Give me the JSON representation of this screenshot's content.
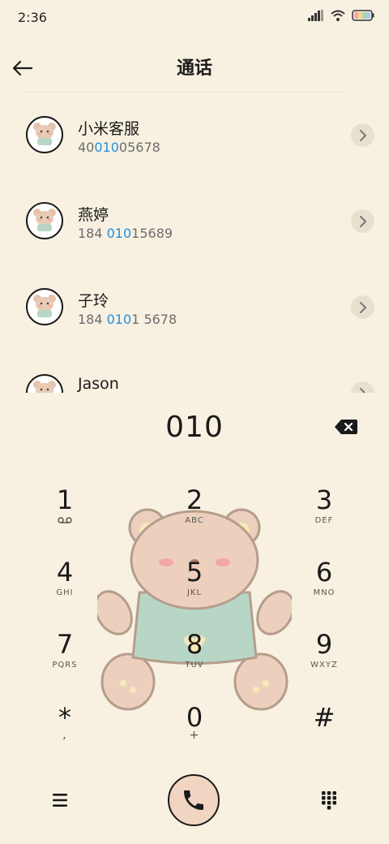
{
  "status": {
    "time": "2:36"
  },
  "header": {
    "title": "通话"
  },
  "contacts": [
    {
      "name": "小米客服",
      "num_pre": "40",
      "num_hl": "010",
      "num_post": "05678"
    },
    {
      "name": "燕婷",
      "num_pre": "184 ",
      "num_hl": "010",
      "num_post": "15689"
    },
    {
      "name": "子玲",
      "num_pre": "184 ",
      "num_hl": "010",
      "num_post": "1 5678"
    },
    {
      "name": "Jason",
      "num_pre": "",
      "num_hl": "",
      "num_post": ""
    }
  ],
  "dialer": {
    "number": "010",
    "keys": [
      {
        "digit": "1",
        "letters": ""
      },
      {
        "digit": "2",
        "letters": "ABC"
      },
      {
        "digit": "3",
        "letters": "DEF"
      },
      {
        "digit": "4",
        "letters": "GHI"
      },
      {
        "digit": "5",
        "letters": "JKL"
      },
      {
        "digit": "6",
        "letters": "MNO"
      },
      {
        "digit": "7",
        "letters": "PQRS"
      },
      {
        "digit": "8",
        "letters": "TUV"
      },
      {
        "digit": "9",
        "letters": "WXYZ"
      },
      {
        "digit": "*",
        "letters": ","
      },
      {
        "digit": "0",
        "letters": "+"
      },
      {
        "digit": "#",
        "letters": ""
      }
    ]
  },
  "colors": {
    "background": "#f8f1e1",
    "highlight": "#1f8fe3",
    "call_button": "#f2d4c3"
  },
  "icons": {
    "back": "arrow-left-icon",
    "backspace": "backspace-icon",
    "menu": "menu-icon",
    "call": "phone-icon",
    "keypad": "keypad-icon",
    "voicemail": "voicemail-icon"
  }
}
